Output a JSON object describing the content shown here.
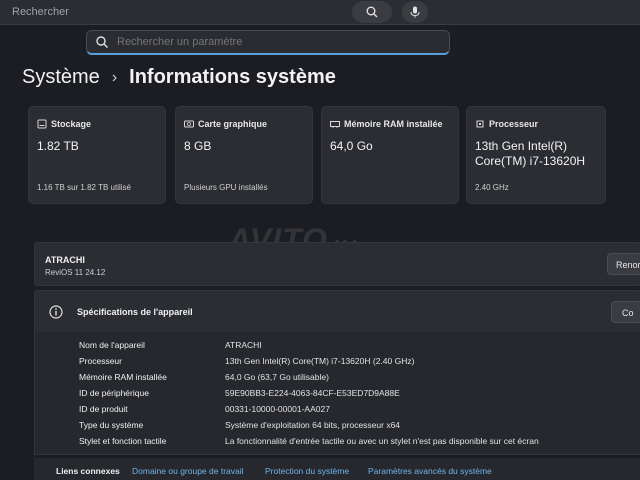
{
  "browser": {
    "search_placeholder": "Rechercher"
  },
  "search": {
    "placeholder": "Rechercher un paramètre"
  },
  "breadcrumb": {
    "parent": "Système",
    "separator": "›",
    "current": "Informations système"
  },
  "cards": [
    {
      "label": "Stockage",
      "value": "1.82 TB",
      "sub": "1.16 TB sur 1.82 TB utilisé",
      "icon": "storage-icon"
    },
    {
      "label": "Carte graphique",
      "value": "8 GB",
      "sub": "Plusieurs GPU installés",
      "icon": "gpu-icon"
    },
    {
      "label": "Mémoire RAM installée",
      "value": "64,0 Go",
      "sub": "",
      "icon": "ram-icon"
    },
    {
      "label": "Processeur",
      "value_line1": "13th Gen Intel(R)",
      "value_line2": "Core(TM) i7-13620H",
      "sub": "2.40 GHz",
      "icon": "processor-icon"
    }
  ],
  "device": {
    "name": "ATRACHI",
    "os": "ReviOS 11 24.12",
    "rename_label": "Renor"
  },
  "specs": {
    "title": "Spécifications de l'appareil",
    "copy_label": "Co",
    "rows": [
      {
        "key": "Nom de l'appareil",
        "value": "ATRACHI"
      },
      {
        "key": "Processeur",
        "value": "13th Gen Intel(R) Core(TM) i7-13620H (2.40 GHz)"
      },
      {
        "key": "Mémoire RAM installée",
        "value": "64,0 Go (63,7 Go utilisable)"
      },
      {
        "key": "ID de périphérique",
        "value": "59E90BB3-E224-4063-84CF-E53ED7D9A88E"
      },
      {
        "key": "ID de produit",
        "value": "00331-10000-00001-AA027"
      },
      {
        "key": "Type du système",
        "value": "Système d'exploitation 64 bits, processeur x64"
      },
      {
        "key": "Stylet et fonction tactile",
        "value": "La fonctionnalité d'entrée tactile ou avec un stylet n'est pas disponible sur cet écran"
      }
    ]
  },
  "related_links": {
    "label": "Liens connexes",
    "links": [
      "Domaine ou groupe de travail",
      "Protection du système",
      "Paramètres avancés du système"
    ]
  },
  "watermark": {
    "main": "AVITO",
    "suffix": ".MA"
  },
  "colors": {
    "background": "#1c1d22",
    "card": "#2b2d33",
    "accent": "#5aa0d8",
    "link": "#6fb4ea"
  }
}
